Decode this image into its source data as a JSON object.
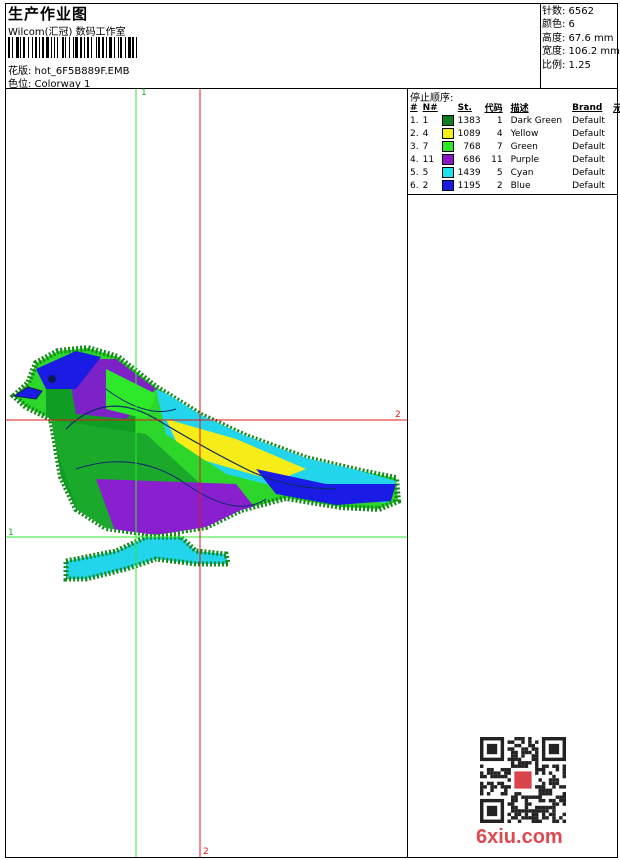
{
  "header": {
    "title": "生产作业图",
    "company": "Wilcom(汇冠) 数码工作室",
    "design_file": "花版: hot_6F5B889F.EMB",
    "colorway": "色位: Colorway 1"
  },
  "stats": {
    "stitches": "针数: 6562",
    "colors": "颜色: 6",
    "height": "高度: 67.6 mm",
    "width": "宽度: 106.2 mm",
    "scale": "比例: 1.25"
  },
  "stop_sequence": {
    "label": "停止顺序:",
    "headers": [
      "#",
      "N#",
      "St.",
      "代码",
      "描述",
      "Brand",
      "元素"
    ],
    "rows": [
      {
        "seq": "1.",
        "needle": "1",
        "stitches": "1383",
        "code": "1",
        "desc": "Dark Green",
        "brand": "Default",
        "color": "#0a7d1f"
      },
      {
        "seq": "2.",
        "needle": "4",
        "stitches": "1089",
        "code": "4",
        "desc": "Yellow",
        "brand": "Default",
        "color": "#f7ef1a"
      },
      {
        "seq": "3.",
        "needle": "7",
        "stitches": "768",
        "code": "7",
        "desc": "Green",
        "brand": "Default",
        "color": "#2ee82a"
      },
      {
        "seq": "4.",
        "needle": "11",
        "stitches": "686",
        "code": "11",
        "desc": "Purple",
        "brand": "Default",
        "color": "#8b14c8"
      },
      {
        "seq": "5.",
        "needle": "5",
        "stitches": "1439",
        "code": "5",
        "desc": "Cyan",
        "brand": "Default",
        "color": "#19e4ee"
      },
      {
        "seq": "6.",
        "needle": "2",
        "stitches": "1195",
        "code": "2",
        "desc": "Blue",
        "brand": "Default",
        "color": "#1a1ae6"
      }
    ]
  },
  "guides": {
    "green_label_1": "1",
    "green_label_2": "1",
    "red_label_1": "2",
    "red_label_2": "2"
  },
  "watermark": "6xiu.com"
}
